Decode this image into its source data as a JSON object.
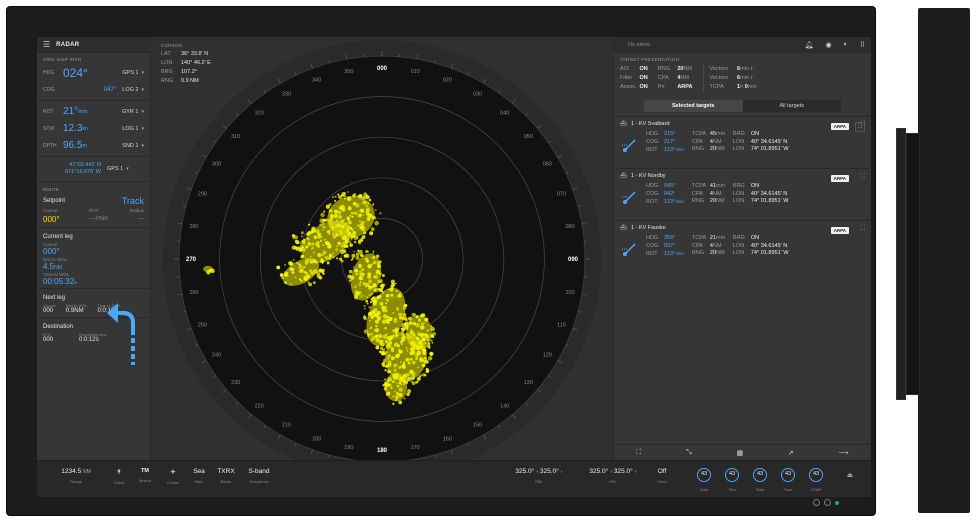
{
  "app": {
    "title": "RADAR"
  },
  "own_ship": {
    "section_label": "OWN SHIP INFO",
    "rows": [
      {
        "label": "HDG",
        "value": "024°",
        "unit": "",
        "source": "GPS 1"
      },
      {
        "label": "COG",
        "value": "",
        "unit": "047°",
        "source": "LOG 2"
      },
      {
        "label": "ROT",
        "value": "21°",
        "unit": "/min",
        "source": "GYR 1"
      },
      {
        "label": "STW",
        "value": "12.3",
        "unit": "kn",
        "source": "LOG 1"
      },
      {
        "label": "DPTH",
        "value": "96.5",
        "unit": "m",
        "source": "SND 1"
      }
    ],
    "lat": "41°03.441' N",
    "lon": "071°16.676' W",
    "pos_source": "GPS 1"
  },
  "route": {
    "section_label": "ROUTE",
    "setpoint_label": "Setpoint",
    "setpoint_mode": "Track",
    "setpoint_cols": [
      "Course",
      "ROT",
      "Radius"
    ],
    "setpoint_vals": [
      "000°",
      "---/min",
      "---"
    ],
    "current_leg": {
      "title": "Current leg",
      "course_label": "Course",
      "course_value": "000°",
      "dist_label": "Dist to WOL",
      "dist_value": "4.5",
      "dist_unit": "NM",
      "time_label": "Time to WOL",
      "time_value": "00:05:32",
      "time_unit": "s"
    },
    "next_leg": {
      "title": "Next leg",
      "cols": [
        "Course",
        "Dist to WOL",
        "Time to WOL"
      ],
      "vals": [
        "000",
        "0.9NM",
        "0:0:12s"
      ]
    },
    "destination": {
      "title": "Destination",
      "cols": [
        "ETA",
        "Remaining time"
      ],
      "vals": [
        "000",
        "0:0:12s"
      ]
    }
  },
  "cursor": {
    "label": "CURSOR",
    "lat_label": "LAT",
    "lat": "36° 33.8' N",
    "lon_label": "LON",
    "lon": "140° 46.2' E",
    "brg_label": "BRG",
    "brg": "107.2°",
    "rng_label": "RNG",
    "rng": "0.9 NM"
  },
  "radar": {
    "bearing_labels": [
      "000",
      "010",
      "020",
      "030",
      "040",
      "050",
      "060",
      "070",
      "080",
      "090",
      "100",
      "110",
      "120",
      "130",
      "140",
      "150",
      "160",
      "170",
      "180",
      "190",
      "200",
      "210",
      "220",
      "230",
      "240",
      "250",
      "260",
      "270",
      "280",
      "290",
      "300",
      "310",
      "320",
      "330",
      "340",
      "350"
    ]
  },
  "alerts": {
    "text": "No alerts"
  },
  "target_presentation": {
    "label": "TARGET PRESENTATION",
    "col1": [
      {
        "k": "AIS",
        "v": "ON"
      },
      {
        "k": "Filter",
        "v": "ON"
      },
      {
        "k": "Assoc.",
        "v": "ON"
      }
    ],
    "col2": [
      {
        "k": "RNG",
        "v": "20",
        "u": "NM"
      },
      {
        "k": "CPA",
        "v": "4",
        "u": "NM"
      },
      {
        "k": "Pri",
        "v": "ARPA",
        "u": ""
      }
    ],
    "col3": [
      {
        "k": "Vectors",
        "v": "6",
        "u": "min"
      },
      {
        "k": "Vectors",
        "v": "6",
        "u": "min"
      },
      {
        "k": "TCPA",
        "v": "1",
        "u": "h",
        "v2": "0",
        "u2": "min"
      }
    ]
  },
  "tabs": {
    "selected": "Selected targets",
    "all": "All targets"
  },
  "targets": [
    {
      "name": "1 - KV Svalbard",
      "tag": "ARPA",
      "hdg": "215°",
      "cog": "217°",
      "rot": "123°",
      "rot_unit": "/min",
      "tcpa": "45",
      "tcpa_u": "min",
      "cpa": "4",
      "cpa_u": "NM",
      "rng": "20",
      "rng_u": "NM",
      "brg": "ON",
      "lon1": "40° 34.6145' N",
      "lon2": "74° 01.8951' W"
    },
    {
      "name": "1 - KV Nordby",
      "tag": "ARPA",
      "hdg": "045°",
      "cog": "042°",
      "rot": "123°",
      "rot_unit": "/min",
      "tcpa": "41",
      "tcpa_u": "min",
      "cpa": "4",
      "cpa_u": "NM",
      "rng": "20",
      "rng_u": "NM",
      "brg": "ON",
      "lon1": "40° 34.6145' N",
      "lon2": "74° 01.8951' W"
    },
    {
      "name": "1 - KV Fauske",
      "tag": "ARPA",
      "hdg": "356°",
      "cog": "007°",
      "rot": "123°",
      "rot_unit": "/min",
      "tcpa": "21",
      "tcpa_u": "min",
      "cpa": "4",
      "cpa_u": "NM",
      "rng": "20",
      "rng_u": "NM",
      "brg": "ON",
      "lon1": "40° 34.6145' N",
      "lon2": "74° 01.8951' W"
    }
  ],
  "bottom": {
    "range_value": "1234.5",
    "range_unit": "NM",
    "range_label": "Range",
    "orient_label": "Orient",
    "motion_value": "TM",
    "motion_label": "Motion",
    "center_label": "Center",
    "stab_value": "Sea",
    "stab_label": "Stab.",
    "radar_value": "TXRX",
    "radar_label": "Radar",
    "freq_value": "S-band",
    "freq_label": "Frequency",
    "ebl_value": "325.0°",
    "ebl_value2": "325.0°",
    "ebl_label": "EBL",
    "vrl_value": "325.0°",
    "vrl_value2": "325.0°",
    "vrl_label": "VRL",
    "chart_value": "Off",
    "chart_label": "Chart",
    "knobs": [
      {
        "value": "43",
        "label": "Gain"
      },
      {
        "value": "43",
        "label": "Sea"
      },
      {
        "value": "43",
        "label": "Rain"
      },
      {
        "value": "43",
        "label": "Tune"
      },
      {
        "value": "43",
        "label": "CFAR"
      }
    ]
  },
  "colors": {
    "accent": "#4aa8ff",
    "echo": "#f2f200",
    "scope": "#111111",
    "panel": "#363636"
  }
}
